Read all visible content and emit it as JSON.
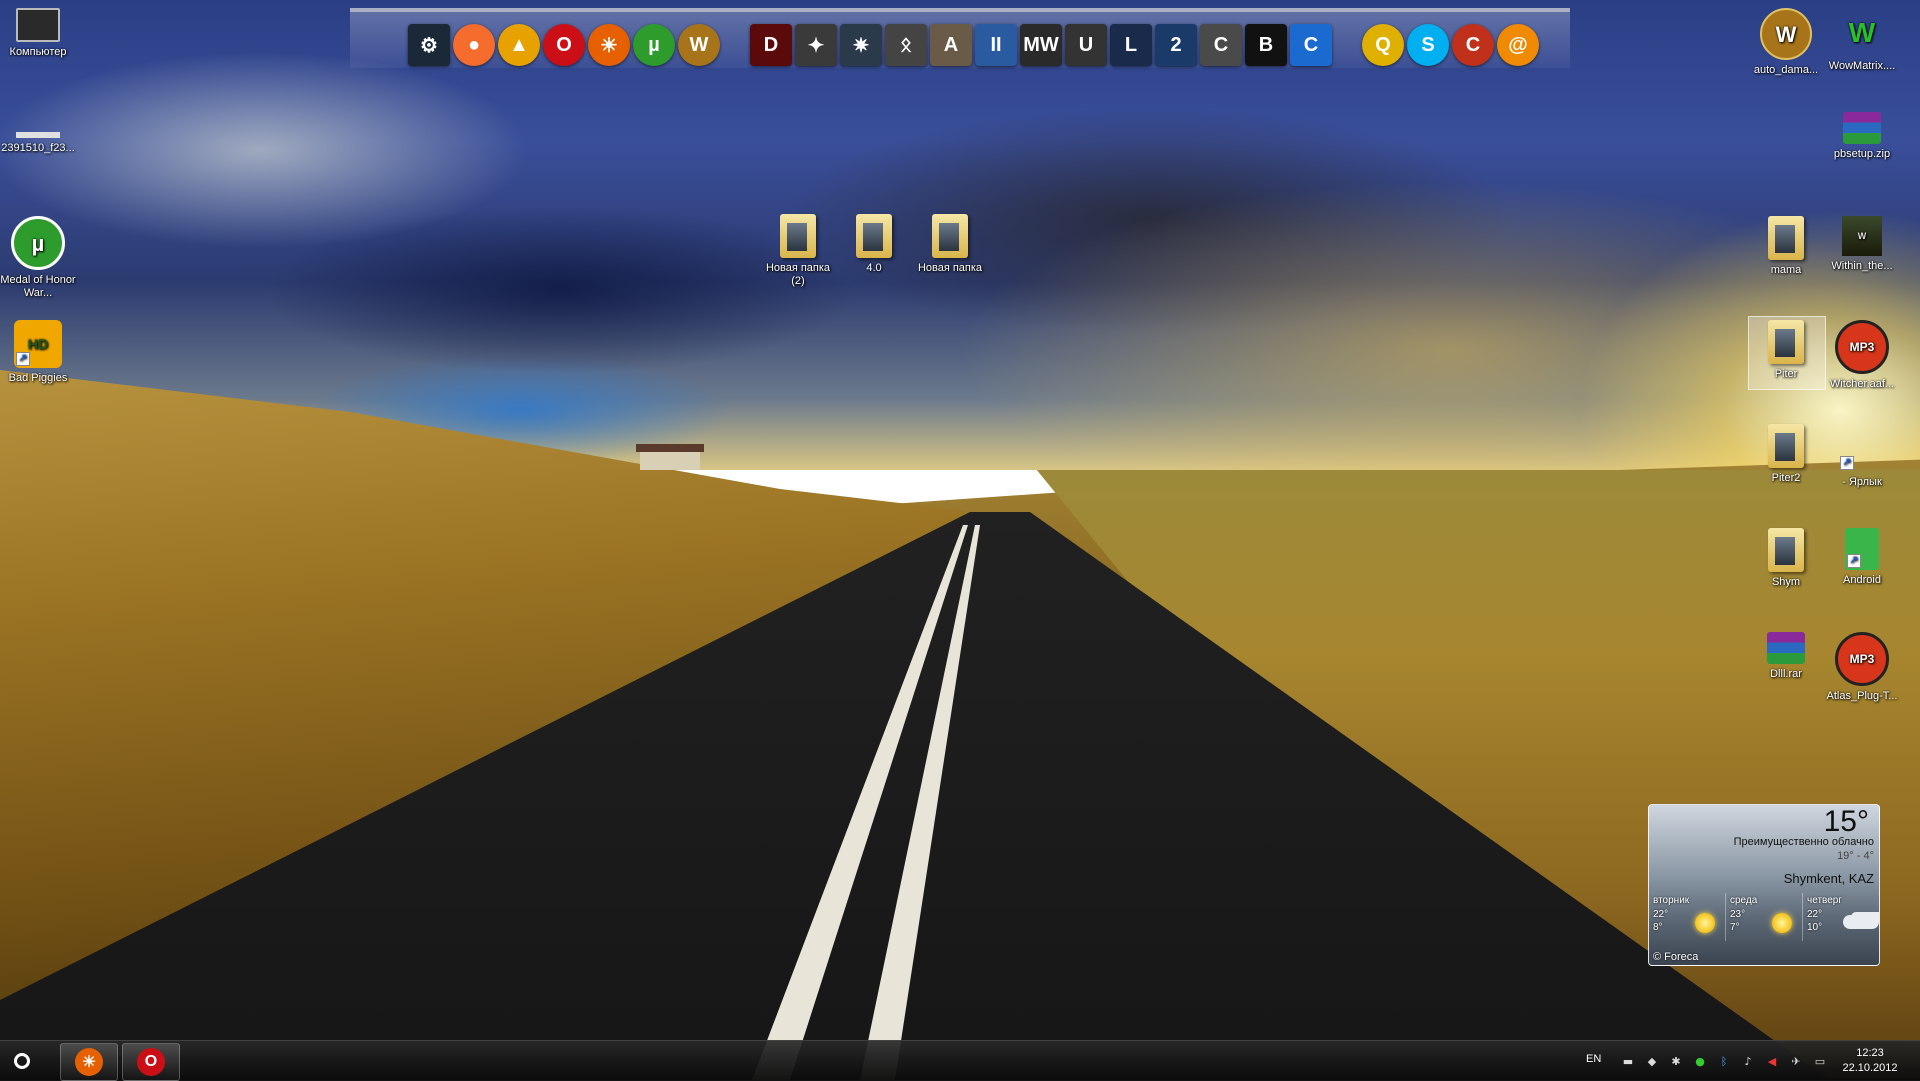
{
  "dock": {
    "items": [
      {
        "name": "steam-icon",
        "glyph": "⚙",
        "bg": "#1b2838",
        "shape": "sq"
      },
      {
        "name": "origin-icon",
        "glyph": "●",
        "bg": "#f56c2d",
        "shape": "round"
      },
      {
        "name": "aimp-icon",
        "glyph": "▲",
        "bg": "#e8a200",
        "shape": "round"
      },
      {
        "name": "opera-icon",
        "glyph": "O",
        "bg": "#cc0f16",
        "shape": "round"
      },
      {
        "name": "firefox-icon",
        "glyph": "☀",
        "bg": "#e66000",
        "shape": "round"
      },
      {
        "name": "utorrent-icon",
        "glyph": "µ",
        "bg": "#2d9c2d",
        "shape": "round"
      },
      {
        "name": "wow-icon",
        "glyph": "W",
        "bg": "#a8741a",
        "shape": "round"
      },
      {
        "name": "gap",
        "glyph": "",
        "bg": "transparent",
        "shape": "gap"
      },
      {
        "name": "diablo-icon",
        "glyph": "D",
        "bg": "#5a0a0a",
        "shape": "sq"
      },
      {
        "name": "witcher-icon",
        "glyph": "✦",
        "bg": "#3a3a3a",
        "shape": "sq"
      },
      {
        "name": "starcraft-icon",
        "glyph": "✷",
        "bg": "#2a3a4a",
        "shape": "sq"
      },
      {
        "name": "skyrim-icon",
        "glyph": "ᛟ",
        "bg": "#444",
        "shape": "sq"
      },
      {
        "name": "assassin-icon",
        "glyph": "A",
        "bg": "#6a5a48",
        "shape": "sq"
      },
      {
        "name": "mafia-icon",
        "glyph": "II",
        "bg": "#2a5aa0",
        "shape": "sq"
      },
      {
        "name": "mw-icon",
        "glyph": "MW",
        "bg": "#2a2a2a",
        "shape": "sq"
      },
      {
        "name": "unreal-icon",
        "glyph": "U",
        "bg": "#333",
        "shape": "sq"
      },
      {
        "name": "lol-icon",
        "glyph": "L",
        "bg": "#1a2a4a",
        "shape": "sq"
      },
      {
        "name": "portal2-icon",
        "glyph": "2",
        "bg": "#1a3a6a",
        "shape": "sq"
      },
      {
        "name": "crysis-icon",
        "glyph": "C",
        "bg": "#4a4a4a",
        "shape": "sq"
      },
      {
        "name": "batman-icon",
        "glyph": "B",
        "bg": "#111",
        "shape": "sq"
      },
      {
        "name": "ccleaner-icon",
        "glyph": "C",
        "bg": "#1a6ad0",
        "shape": "sq"
      },
      {
        "name": "gap",
        "glyph": "",
        "bg": "transparent",
        "shape": "gap"
      },
      {
        "name": "qip-icon",
        "glyph": "Q",
        "bg": "#e0b000",
        "shape": "round"
      },
      {
        "name": "skype-icon",
        "glyph": "S",
        "bg": "#00aff0",
        "shape": "round"
      },
      {
        "name": "ccleaner-brush-icon",
        "glyph": "C",
        "bg": "#c0301a",
        "shape": "round"
      },
      {
        "name": "mail-agent-icon",
        "glyph": "@",
        "bg": "#f08a00",
        "shape": "round"
      }
    ]
  },
  "desktop": {
    "left": [
      {
        "name": "computer",
        "label": "Компьютер",
        "type": "computer"
      },
      {
        "name": "file-2391510",
        "label": "2391510_f23...",
        "type": "file"
      },
      {
        "name": "medal-of-honor",
        "label": "Medal of Honor War...",
        "type": "utorrent"
      },
      {
        "name": "bad-piggies",
        "label": "Bad Piggies",
        "type": "piggies"
      }
    ],
    "center": [
      {
        "name": "new-folder-2",
        "label": "Новая папка (2)"
      },
      {
        "name": "folder-4-0",
        "label": "4.0"
      },
      {
        "name": "new-folder",
        "label": "Новая папка"
      }
    ],
    "right": [
      {
        "name": "auto-dama",
        "label": "auto_dama...",
        "type": "wow"
      },
      {
        "name": "wowmatrix",
        "label": "WowMatrix....",
        "type": "wm"
      },
      {
        "name": "pbsetup",
        "label": "pbsetup.zip",
        "type": "rar"
      },
      {
        "name": "mama",
        "label": "mama",
        "type": "folder"
      },
      {
        "name": "within-the",
        "label": "Within_the...",
        "type": "witcher"
      },
      {
        "name": "piter",
        "label": "Piter",
        "type": "folder"
      },
      {
        "name": "witcher-mp3",
        "label": "Witcher.aaf...",
        "type": "mp3"
      },
      {
        "name": "piter2",
        "label": "Piter2",
        "type": "folder"
      },
      {
        "name": "yarlyk",
        "label": "- Ярлык",
        "type": "shortcut"
      },
      {
        "name": "shym",
        "label": "Shym",
        "type": "folder"
      },
      {
        "name": "android",
        "label": "Android",
        "type": "android"
      },
      {
        "name": "dlll-rar",
        "label": "Dlll.rar",
        "type": "rar"
      },
      {
        "name": "atlas-plug",
        "label": "Atlas_Plug-T...",
        "type": "mp3"
      }
    ]
  },
  "weather": {
    "temp": "15°",
    "desc": "Преимущественно облачно",
    "range": "19° - 4°",
    "city": "Shymkent, KAZ",
    "days": [
      {
        "name": "вторник",
        "hi": "22°",
        "lo": "8°",
        "icon": "sun"
      },
      {
        "name": "среда",
        "hi": "23°",
        "lo": "7°",
        "icon": "sun"
      },
      {
        "name": "четверг",
        "hi": "22°",
        "lo": "10°",
        "icon": "cloud"
      }
    ],
    "credit": "© Foreca"
  },
  "taskbar": {
    "lang": "EN",
    "time": "12:23",
    "date": "22.10.2012",
    "pinned": [
      {
        "name": "taskbar-firefox",
        "glyph": "☀",
        "bg": "#e66000"
      },
      {
        "name": "taskbar-opera",
        "glyph": "O",
        "bg": "#cc0f16"
      }
    ],
    "tray": [
      "network-icon",
      "antivirus-icon",
      "bug-icon",
      "info-icon",
      "bluetooth-icon",
      "volume-icon",
      "flag-icon",
      "updates-icon",
      "display-icon"
    ]
  }
}
